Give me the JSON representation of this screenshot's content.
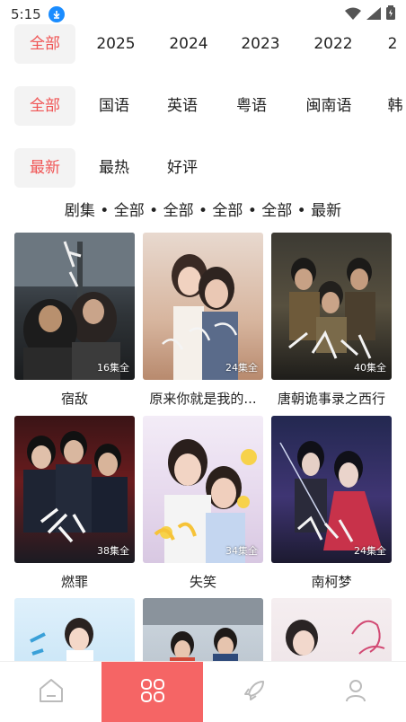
{
  "status": {
    "time": "5:15"
  },
  "filters": {
    "years": [
      {
        "label": "全部",
        "active": true
      },
      {
        "label": "2025",
        "active": false
      },
      {
        "label": "2024",
        "active": false
      },
      {
        "label": "2023",
        "active": false
      },
      {
        "label": "2022",
        "active": false
      },
      {
        "label": "2",
        "active": false
      }
    ],
    "languages": [
      {
        "label": "全部",
        "active": true
      },
      {
        "label": "国语",
        "active": false
      },
      {
        "label": "英语",
        "active": false
      },
      {
        "label": "粤语",
        "active": false
      },
      {
        "label": "闽南语",
        "active": false
      },
      {
        "label": "韩",
        "active": false
      }
    ],
    "sort": [
      {
        "label": "最新",
        "active": true
      },
      {
        "label": "最热",
        "active": false
      },
      {
        "label": "好评",
        "active": false
      }
    ]
  },
  "summary": "剧集 • 全部 • 全部 • 全部 • 全部 • 最新",
  "grid": [
    {
      "title": "宿敌",
      "episodes": "16集全"
    },
    {
      "title": "原来你就是我的...",
      "episodes": "24集全"
    },
    {
      "title": "唐朝诡事录之西行",
      "episodes": "40集全"
    },
    {
      "title": "燃罪",
      "episodes": "38集全"
    },
    {
      "title": "失笑",
      "episodes": "34集全"
    },
    {
      "title": "南柯梦",
      "episodes": "24集全"
    },
    {
      "title": "",
      "episodes": ""
    },
    {
      "title": "",
      "episodes": ""
    },
    {
      "title": "",
      "episodes": ""
    }
  ],
  "colors": {
    "accent": "#f05454",
    "nav_active": "#f56565",
    "chip_bg": "#f3f3f3"
  },
  "nav": [
    {
      "icon": "home-icon",
      "active": false
    },
    {
      "icon": "category-grid-icon",
      "active": true
    },
    {
      "icon": "rocket-icon",
      "active": false
    },
    {
      "icon": "profile-icon",
      "active": false
    }
  ]
}
